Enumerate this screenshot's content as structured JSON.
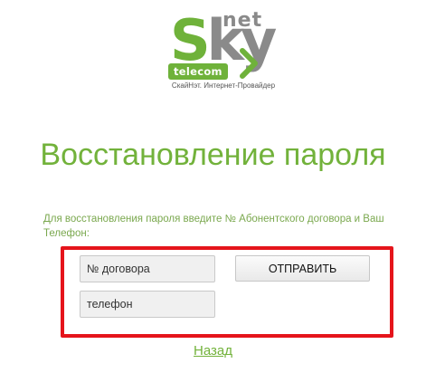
{
  "logo": {
    "letters_s": "S",
    "letters_ky": "ky",
    "net": "net",
    "telecom": "telecom",
    "tagline": "СкайНэт. Интернет-Провайдер",
    "colors": {
      "green": "#6fb23a",
      "gray": "#8a8a8a"
    }
  },
  "page": {
    "title": "Восстановление пароля",
    "instructions": "Для восстановления пароля введите № Абонентского договора и Ваш Телефон:"
  },
  "form": {
    "contract_placeholder": "№ договора",
    "contract_value": "",
    "phone_placeholder": "телефон",
    "phone_value": "",
    "submit_label": "ОТПРАВИТЬ",
    "highlight_color": "#e5141b"
  },
  "nav": {
    "back_label": "Назад"
  }
}
